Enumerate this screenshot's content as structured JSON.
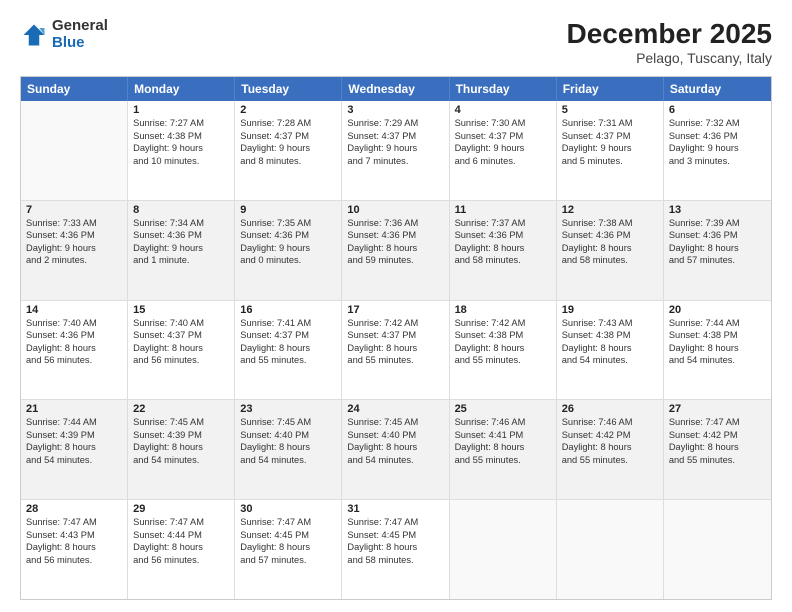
{
  "header": {
    "logo": {
      "general": "General",
      "blue": "Blue"
    },
    "title": "December 2025",
    "location": "Pelago, Tuscany, Italy"
  },
  "weekdays": [
    "Sunday",
    "Monday",
    "Tuesday",
    "Wednesday",
    "Thursday",
    "Friday",
    "Saturday"
  ],
  "rows": [
    [
      {
        "day": "",
        "lines": []
      },
      {
        "day": "1",
        "lines": [
          "Sunrise: 7:27 AM",
          "Sunset: 4:38 PM",
          "Daylight: 9 hours",
          "and 10 minutes."
        ]
      },
      {
        "day": "2",
        "lines": [
          "Sunrise: 7:28 AM",
          "Sunset: 4:37 PM",
          "Daylight: 9 hours",
          "and 8 minutes."
        ]
      },
      {
        "day": "3",
        "lines": [
          "Sunrise: 7:29 AM",
          "Sunset: 4:37 PM",
          "Daylight: 9 hours",
          "and 7 minutes."
        ]
      },
      {
        "day": "4",
        "lines": [
          "Sunrise: 7:30 AM",
          "Sunset: 4:37 PM",
          "Daylight: 9 hours",
          "and 6 minutes."
        ]
      },
      {
        "day": "5",
        "lines": [
          "Sunrise: 7:31 AM",
          "Sunset: 4:37 PM",
          "Daylight: 9 hours",
          "and 5 minutes."
        ]
      },
      {
        "day": "6",
        "lines": [
          "Sunrise: 7:32 AM",
          "Sunset: 4:36 PM",
          "Daylight: 9 hours",
          "and 3 minutes."
        ]
      }
    ],
    [
      {
        "day": "7",
        "lines": [
          "Sunrise: 7:33 AM",
          "Sunset: 4:36 PM",
          "Daylight: 9 hours",
          "and 2 minutes."
        ]
      },
      {
        "day": "8",
        "lines": [
          "Sunrise: 7:34 AM",
          "Sunset: 4:36 PM",
          "Daylight: 9 hours",
          "and 1 minute."
        ]
      },
      {
        "day": "9",
        "lines": [
          "Sunrise: 7:35 AM",
          "Sunset: 4:36 PM",
          "Daylight: 9 hours",
          "and 0 minutes."
        ]
      },
      {
        "day": "10",
        "lines": [
          "Sunrise: 7:36 AM",
          "Sunset: 4:36 PM",
          "Daylight: 8 hours",
          "and 59 minutes."
        ]
      },
      {
        "day": "11",
        "lines": [
          "Sunrise: 7:37 AM",
          "Sunset: 4:36 PM",
          "Daylight: 8 hours",
          "and 58 minutes."
        ]
      },
      {
        "day": "12",
        "lines": [
          "Sunrise: 7:38 AM",
          "Sunset: 4:36 PM",
          "Daylight: 8 hours",
          "and 58 minutes."
        ]
      },
      {
        "day": "13",
        "lines": [
          "Sunrise: 7:39 AM",
          "Sunset: 4:36 PM",
          "Daylight: 8 hours",
          "and 57 minutes."
        ]
      }
    ],
    [
      {
        "day": "14",
        "lines": [
          "Sunrise: 7:40 AM",
          "Sunset: 4:36 PM",
          "Daylight: 8 hours",
          "and 56 minutes."
        ]
      },
      {
        "day": "15",
        "lines": [
          "Sunrise: 7:40 AM",
          "Sunset: 4:37 PM",
          "Daylight: 8 hours",
          "and 56 minutes."
        ]
      },
      {
        "day": "16",
        "lines": [
          "Sunrise: 7:41 AM",
          "Sunset: 4:37 PM",
          "Daylight: 8 hours",
          "and 55 minutes."
        ]
      },
      {
        "day": "17",
        "lines": [
          "Sunrise: 7:42 AM",
          "Sunset: 4:37 PM",
          "Daylight: 8 hours",
          "and 55 minutes."
        ]
      },
      {
        "day": "18",
        "lines": [
          "Sunrise: 7:42 AM",
          "Sunset: 4:38 PM",
          "Daylight: 8 hours",
          "and 55 minutes."
        ]
      },
      {
        "day": "19",
        "lines": [
          "Sunrise: 7:43 AM",
          "Sunset: 4:38 PM",
          "Daylight: 8 hours",
          "and 54 minutes."
        ]
      },
      {
        "day": "20",
        "lines": [
          "Sunrise: 7:44 AM",
          "Sunset: 4:38 PM",
          "Daylight: 8 hours",
          "and 54 minutes."
        ]
      }
    ],
    [
      {
        "day": "21",
        "lines": [
          "Sunrise: 7:44 AM",
          "Sunset: 4:39 PM",
          "Daylight: 8 hours",
          "and 54 minutes."
        ]
      },
      {
        "day": "22",
        "lines": [
          "Sunrise: 7:45 AM",
          "Sunset: 4:39 PM",
          "Daylight: 8 hours",
          "and 54 minutes."
        ]
      },
      {
        "day": "23",
        "lines": [
          "Sunrise: 7:45 AM",
          "Sunset: 4:40 PM",
          "Daylight: 8 hours",
          "and 54 minutes."
        ]
      },
      {
        "day": "24",
        "lines": [
          "Sunrise: 7:45 AM",
          "Sunset: 4:40 PM",
          "Daylight: 8 hours",
          "and 54 minutes."
        ]
      },
      {
        "day": "25",
        "lines": [
          "Sunrise: 7:46 AM",
          "Sunset: 4:41 PM",
          "Daylight: 8 hours",
          "and 55 minutes."
        ]
      },
      {
        "day": "26",
        "lines": [
          "Sunrise: 7:46 AM",
          "Sunset: 4:42 PM",
          "Daylight: 8 hours",
          "and 55 minutes."
        ]
      },
      {
        "day": "27",
        "lines": [
          "Sunrise: 7:47 AM",
          "Sunset: 4:42 PM",
          "Daylight: 8 hours",
          "and 55 minutes."
        ]
      }
    ],
    [
      {
        "day": "28",
        "lines": [
          "Sunrise: 7:47 AM",
          "Sunset: 4:43 PM",
          "Daylight: 8 hours",
          "and 56 minutes."
        ]
      },
      {
        "day": "29",
        "lines": [
          "Sunrise: 7:47 AM",
          "Sunset: 4:44 PM",
          "Daylight: 8 hours",
          "and 56 minutes."
        ]
      },
      {
        "day": "30",
        "lines": [
          "Sunrise: 7:47 AM",
          "Sunset: 4:45 PM",
          "Daylight: 8 hours",
          "and 57 minutes."
        ]
      },
      {
        "day": "31",
        "lines": [
          "Sunrise: 7:47 AM",
          "Sunset: 4:45 PM",
          "Daylight: 8 hours",
          "and 58 minutes."
        ]
      },
      {
        "day": "",
        "lines": []
      },
      {
        "day": "",
        "lines": []
      },
      {
        "day": "",
        "lines": []
      }
    ]
  ]
}
